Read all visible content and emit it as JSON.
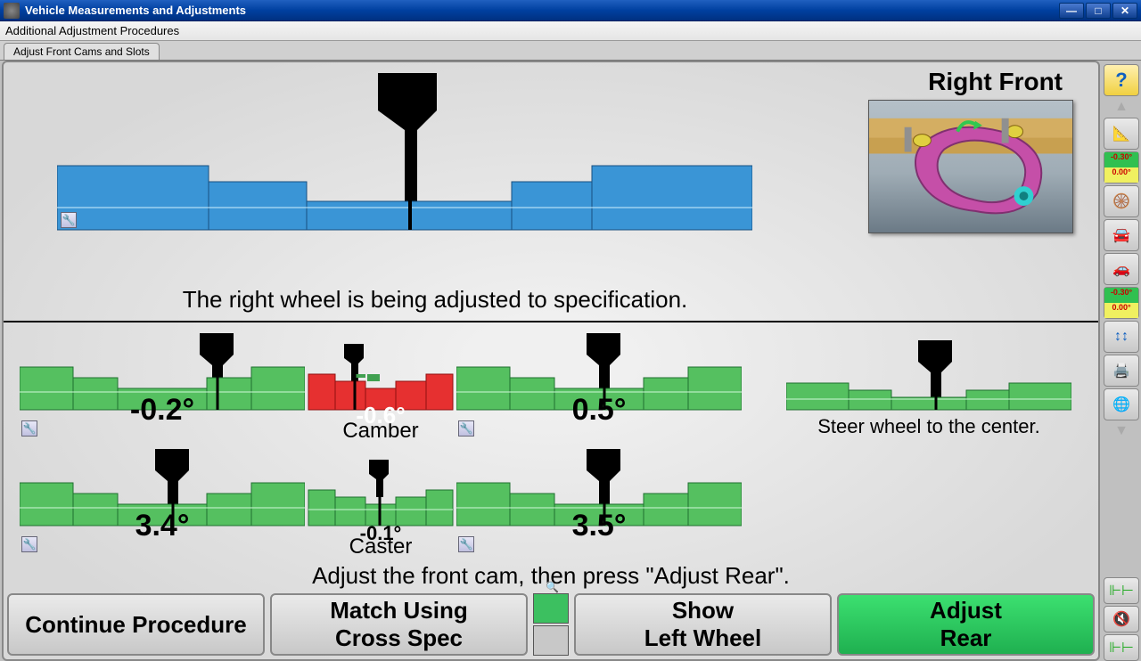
{
  "window": {
    "title": "Vehicle Measurements and Adjustments"
  },
  "menu": {
    "item1": "Additional Adjustment Procedures"
  },
  "tab": {
    "active": "Adjust Front Cams and Slots"
  },
  "top": {
    "corner": "Right Front",
    "status": "The right wheel is being adjusted to specification."
  },
  "gauges": {
    "camber_left": "-0.2°",
    "camber_cross": "-0.6°",
    "camber_right": "0.5°",
    "camber_label": "Camber",
    "caster_left": "3.4°",
    "caster_cross": "-0.1°",
    "caster_right": "3.5°",
    "caster_label": "Caster",
    "steer_label": "Steer wheel to the center."
  },
  "instruction": "Adjust the front cam, then press \"Adjust Rear\".",
  "buttons": {
    "b1l1": "Continue Procedure",
    "b2l1": "Match Using",
    "b2l2": "Cross Spec",
    "b3l1": "Show",
    "b3l2": "Left Wheel",
    "b4l1": "Adjust",
    "b4l2": "Rear"
  },
  "side": {
    "val1": "-0.30°",
    "val2": "0.00°",
    "val3": "-0.30°",
    "val4": "0.00°"
  }
}
